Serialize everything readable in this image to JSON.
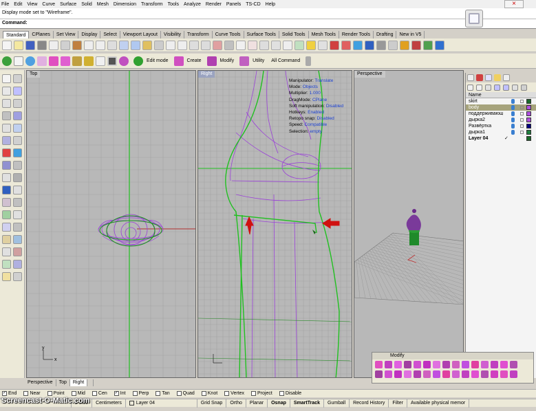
{
  "menu": [
    "File",
    "Edit",
    "View",
    "Curve",
    "Surface",
    "Solid",
    "Mesh",
    "Dimension",
    "Transform",
    "Tools",
    "Analyze",
    "Render",
    "Panels",
    "TS-CD",
    "Help"
  ],
  "command_history": "Display mode set to \"Wireframe\".",
  "command_prompt": "Command:",
  "toolbar_tabs": [
    "Standard",
    "CPlanes",
    "Set View",
    "Display",
    "Select",
    "Viewport Layout",
    "Visibility",
    "Transform",
    "Curve Tools",
    "Surface Tools",
    "Solid Tools",
    "Mesh Tools",
    "Render Tools",
    "Drafting",
    "New in V5"
  ],
  "selected_toolbar_tab": "Standard",
  "toolrow2_labels": {
    "edit_mode": "Edit mode",
    "create": "Create",
    "modify": "Modify",
    "utility": "Utility",
    "all_command": "All Command"
  },
  "viewports": {
    "top": "Top",
    "right": "Right",
    "perspective": "Perspective"
  },
  "viewport_info": [
    {
      "key": "Manipulator:",
      "value": "Translate"
    },
    {
      "key": "Mode:",
      "value": "Objects"
    },
    {
      "key": "Multiplier:",
      "value": "1.000"
    },
    {
      "key": "DragMode:",
      "value": "CPlane"
    },
    {
      "key": "Soft manipulation:",
      "value": "Disabled"
    },
    {
      "key": "Hotkeys:",
      "value": "Enabled"
    },
    {
      "key": "Retopo snap:",
      "value": "Disabled"
    },
    {
      "key": "Speed:",
      "value": "Compatible"
    },
    {
      "key": "Selection:",
      "value": "empty"
    }
  ],
  "axis_labels": {
    "x": "x",
    "y": "y"
  },
  "viewport_tabs": [
    "Perspective",
    "Top",
    "Right"
  ],
  "selected_viewport_tab": "Right",
  "layers": {
    "header": "Name",
    "rows": [
      {
        "name": "skirt",
        "color": "#00c0ff",
        "selected": false,
        "bold": false
      },
      {
        "name": "body",
        "color": "#b050e0",
        "selected": true,
        "bold": false
      },
      {
        "name": "поддерживающая",
        "color": "#b050e0",
        "selected": false,
        "bold": false
      },
      {
        "name": "дырка2",
        "color": "#b050e0",
        "selected": false,
        "bold": false
      },
      {
        "name": "Развёртка",
        "color": "#000080",
        "selected": false,
        "bold": false
      },
      {
        "name": "дырка1",
        "color": "#208040",
        "selected": false,
        "bold": false
      },
      {
        "name": "Layer 04",
        "color": "#1a6a2a",
        "selected": false,
        "bold": true
      }
    ],
    "current_mark": "✓"
  },
  "modify_panel": {
    "title": "Modify"
  },
  "osnaps": [
    {
      "label": "End",
      "checked": true
    },
    {
      "label": "Near",
      "checked": false
    },
    {
      "label": "Point",
      "checked": false
    },
    {
      "label": "Mid",
      "checked": false
    },
    {
      "label": "Cen",
      "checked": false
    },
    {
      "label": "Int",
      "checked": true
    },
    {
      "label": "Perp",
      "checked": false
    },
    {
      "label": "Tan",
      "checked": false
    },
    {
      "label": "Quad",
      "checked": false
    },
    {
      "label": "Knot",
      "checked": false
    },
    {
      "label": "Vertex",
      "checked": false
    },
    {
      "label": "Project",
      "checked": false
    },
    {
      "label": "Disable",
      "checked": false
    }
  ],
  "status": {
    "coord": "z 0.00",
    "units": "Centimeters",
    "layer": "Layer 04",
    "layer_color": "#1a6a2a",
    "panes": [
      "Grid Snap",
      "Ortho",
      "Planar",
      "Osnap",
      "SmartTrack",
      "Gumball",
      "Record History",
      "Filter",
      "Available physical memor"
    ],
    "bold_panes": [
      "Osnap",
      "SmartTrack"
    ]
  },
  "watermark": "Screencast-O-Matic.com",
  "colors": {
    "grid_bg": "#b8b8b8",
    "grid_line": "#a4a4a4",
    "purple": "#9a40d8",
    "green": "#20c020",
    "red_arrow": "#d01010",
    "accent": "#9aa3c0"
  }
}
